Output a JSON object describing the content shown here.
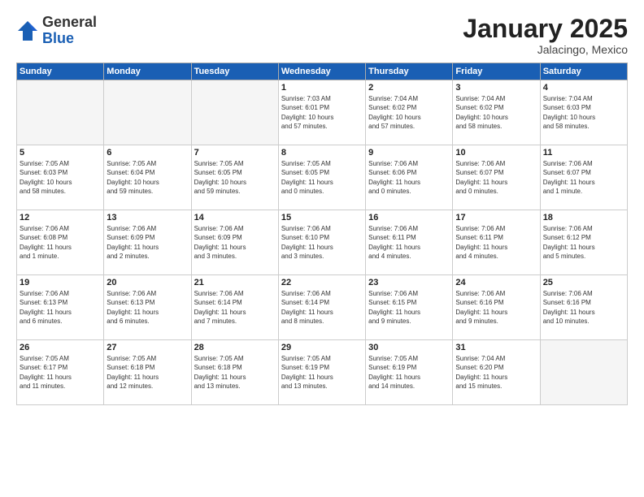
{
  "logo": {
    "general": "General",
    "blue": "Blue"
  },
  "title": "January 2025",
  "subtitle": "Jalacingo, Mexico",
  "header_days": [
    "Sunday",
    "Monday",
    "Tuesday",
    "Wednesday",
    "Thursday",
    "Friday",
    "Saturday"
  ],
  "weeks": [
    [
      {
        "day": "",
        "info": ""
      },
      {
        "day": "",
        "info": ""
      },
      {
        "day": "",
        "info": ""
      },
      {
        "day": "1",
        "info": "Sunrise: 7:03 AM\nSunset: 6:01 PM\nDaylight: 10 hours\nand 57 minutes."
      },
      {
        "day": "2",
        "info": "Sunrise: 7:04 AM\nSunset: 6:02 PM\nDaylight: 10 hours\nand 57 minutes."
      },
      {
        "day": "3",
        "info": "Sunrise: 7:04 AM\nSunset: 6:02 PM\nDaylight: 10 hours\nand 58 minutes."
      },
      {
        "day": "4",
        "info": "Sunrise: 7:04 AM\nSunset: 6:03 PM\nDaylight: 10 hours\nand 58 minutes."
      }
    ],
    [
      {
        "day": "5",
        "info": "Sunrise: 7:05 AM\nSunset: 6:03 PM\nDaylight: 10 hours\nand 58 minutes."
      },
      {
        "day": "6",
        "info": "Sunrise: 7:05 AM\nSunset: 6:04 PM\nDaylight: 10 hours\nand 59 minutes."
      },
      {
        "day": "7",
        "info": "Sunrise: 7:05 AM\nSunset: 6:05 PM\nDaylight: 10 hours\nand 59 minutes."
      },
      {
        "day": "8",
        "info": "Sunrise: 7:05 AM\nSunset: 6:05 PM\nDaylight: 11 hours\nand 0 minutes."
      },
      {
        "day": "9",
        "info": "Sunrise: 7:06 AM\nSunset: 6:06 PM\nDaylight: 11 hours\nand 0 minutes."
      },
      {
        "day": "10",
        "info": "Sunrise: 7:06 AM\nSunset: 6:07 PM\nDaylight: 11 hours\nand 0 minutes."
      },
      {
        "day": "11",
        "info": "Sunrise: 7:06 AM\nSunset: 6:07 PM\nDaylight: 11 hours\nand 1 minute."
      }
    ],
    [
      {
        "day": "12",
        "info": "Sunrise: 7:06 AM\nSunset: 6:08 PM\nDaylight: 11 hours\nand 1 minute."
      },
      {
        "day": "13",
        "info": "Sunrise: 7:06 AM\nSunset: 6:09 PM\nDaylight: 11 hours\nand 2 minutes."
      },
      {
        "day": "14",
        "info": "Sunrise: 7:06 AM\nSunset: 6:09 PM\nDaylight: 11 hours\nand 3 minutes."
      },
      {
        "day": "15",
        "info": "Sunrise: 7:06 AM\nSunset: 6:10 PM\nDaylight: 11 hours\nand 3 minutes."
      },
      {
        "day": "16",
        "info": "Sunrise: 7:06 AM\nSunset: 6:11 PM\nDaylight: 11 hours\nand 4 minutes."
      },
      {
        "day": "17",
        "info": "Sunrise: 7:06 AM\nSunset: 6:11 PM\nDaylight: 11 hours\nand 4 minutes."
      },
      {
        "day": "18",
        "info": "Sunrise: 7:06 AM\nSunset: 6:12 PM\nDaylight: 11 hours\nand 5 minutes."
      }
    ],
    [
      {
        "day": "19",
        "info": "Sunrise: 7:06 AM\nSunset: 6:13 PM\nDaylight: 11 hours\nand 6 minutes."
      },
      {
        "day": "20",
        "info": "Sunrise: 7:06 AM\nSunset: 6:13 PM\nDaylight: 11 hours\nand 6 minutes."
      },
      {
        "day": "21",
        "info": "Sunrise: 7:06 AM\nSunset: 6:14 PM\nDaylight: 11 hours\nand 7 minutes."
      },
      {
        "day": "22",
        "info": "Sunrise: 7:06 AM\nSunset: 6:14 PM\nDaylight: 11 hours\nand 8 minutes."
      },
      {
        "day": "23",
        "info": "Sunrise: 7:06 AM\nSunset: 6:15 PM\nDaylight: 11 hours\nand 9 minutes."
      },
      {
        "day": "24",
        "info": "Sunrise: 7:06 AM\nSunset: 6:16 PM\nDaylight: 11 hours\nand 9 minutes."
      },
      {
        "day": "25",
        "info": "Sunrise: 7:06 AM\nSunset: 6:16 PM\nDaylight: 11 hours\nand 10 minutes."
      }
    ],
    [
      {
        "day": "26",
        "info": "Sunrise: 7:05 AM\nSunset: 6:17 PM\nDaylight: 11 hours\nand 11 minutes."
      },
      {
        "day": "27",
        "info": "Sunrise: 7:05 AM\nSunset: 6:18 PM\nDaylight: 11 hours\nand 12 minutes."
      },
      {
        "day": "28",
        "info": "Sunrise: 7:05 AM\nSunset: 6:18 PM\nDaylight: 11 hours\nand 13 minutes."
      },
      {
        "day": "29",
        "info": "Sunrise: 7:05 AM\nSunset: 6:19 PM\nDaylight: 11 hours\nand 13 minutes."
      },
      {
        "day": "30",
        "info": "Sunrise: 7:05 AM\nSunset: 6:19 PM\nDaylight: 11 hours\nand 14 minutes."
      },
      {
        "day": "31",
        "info": "Sunrise: 7:04 AM\nSunset: 6:20 PM\nDaylight: 11 hours\nand 15 minutes."
      },
      {
        "day": "",
        "info": ""
      }
    ]
  ]
}
